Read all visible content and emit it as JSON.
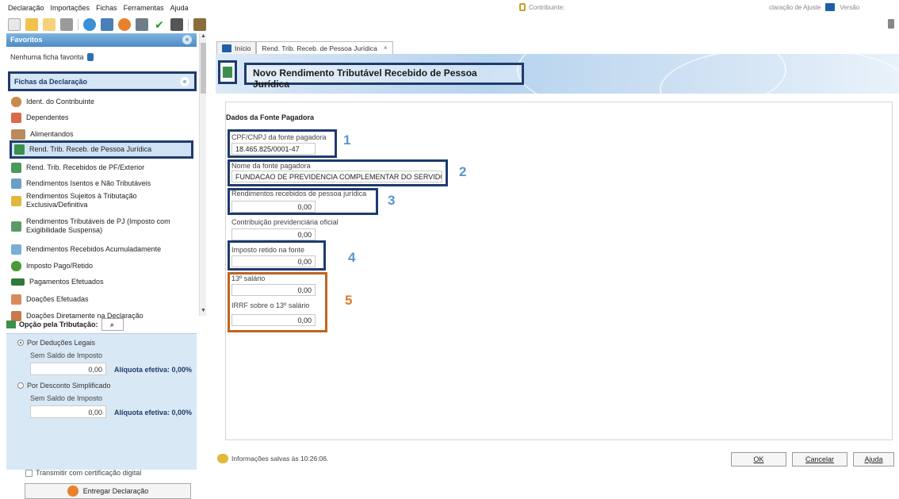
{
  "menu": [
    "Declaração",
    "Importações",
    "Fichas",
    "Ferramentas",
    "Ajuda"
  ],
  "top_status": {
    "contribuinte_label": "Contribuinte:",
    "declaracao_label": "claração de Ajuste",
    "versao_label": "Versão"
  },
  "sidebar": {
    "favoritos_header": "Favoritos",
    "favoritos_empty": "Nenhuma ficha favorita",
    "fichas_header": "Fichas da Declaração",
    "items": [
      {
        "label": "Ident. do Contribuinte",
        "icon": "person-icon"
      },
      {
        "label": "Dependentes",
        "icon": "dependents-icon"
      },
      {
        "label": "Alimentandos",
        "icon": "alimentandos-icon"
      },
      {
        "label": "Rend. Trib. Receb. de Pessoa Jurídica",
        "icon": "rendimento-pj-icon"
      },
      {
        "label": "Rend. Trib. Recebidos de PF/Exterior",
        "icon": "rendimento-pf-icon"
      },
      {
        "label": "Rendimentos Isentos e Não Tributáveis",
        "icon": "isentos-icon"
      },
      {
        "label": "Rendimentos Sujeitos à Tributação Exclusiva/Definitiva",
        "icon": "exclusiva-icon"
      },
      {
        "label": "Rendimentos Tributáveis de PJ (Imposto com Exigibilidade Suspensa)",
        "icon": "suspensa-icon"
      },
      {
        "label": "Rendimentos Recebidos Acumuladamente",
        "icon": "acumulados-icon"
      },
      {
        "label": "Imposto Pago/Retido",
        "icon": "imposto-pago-icon"
      },
      {
        "label": "Pagamentos Efetuados",
        "icon": "pagamentos-icon"
      },
      {
        "label": "Doações Efetuadas",
        "icon": "doacoes-icon"
      },
      {
        "label": "Doações Diretamente na Declaração",
        "icon": "doacoes-diretas-icon"
      }
    ],
    "opcao_label": "Opção pela Tributação:",
    "deducoes_legais": "Por Deduções Legais",
    "sem_saldo_1": "Sem Saldo de Imposto",
    "valor_1": "0,00",
    "aliquota_1": "Alíquota efetiva: 0,00%",
    "desconto_simplificado": "Por Desconto Simplificado",
    "sem_saldo_2": "Sem Saldo de Imposto",
    "valor_2": "0,00",
    "aliquota_2": "Alíquota efetiva: 0,00%",
    "transmitir": "Transmitir com certificação digital",
    "entregar": "Entregar Declaração"
  },
  "tabs": {
    "inicio": "Início",
    "active": "Rend. Trib. Receb. de Pessoa Jurídica",
    "close": "×"
  },
  "banner_title": "Novo Rendimento Tributável Recebido de Pessoa Jurídica",
  "form": {
    "section_title": "Dados da Fonte Pagadora",
    "cpf_cnpj_label": "CPF/CNPJ da fonte pagadora",
    "cpf_cnpj_value": "18.465.825/0001-47",
    "nome_label": "Nome da fonte pagadora",
    "nome_value": "FUNDACAO DE PREVIDENCIA COMPLEMENTAR DO SERVIDOR F",
    "rendimentos_label": "Rendimentos recebidos de pessoa jurídica",
    "rendimentos_value": "0,00",
    "contribuicao_label": "Contribuição previdenciária oficial",
    "contribuicao_value": "0,00",
    "imposto_label": "Imposto retido na fonte",
    "imposto_value": "0,00",
    "decimo_label": "13º salário",
    "decimo_value": "0,00",
    "irrf_decimo_label": "IRRF sobre o 13º salário",
    "irrf_decimo_value": "0,00",
    "callouts": [
      "1",
      "2",
      "3",
      "4",
      "5"
    ]
  },
  "status": {
    "message": "Informações salvas às 10:26:06.",
    "ok": "OK",
    "cancelar": "Cancelar",
    "ajuda": "Ajuda"
  },
  "colors": {
    "highlight_blue": "#1f3b6e",
    "highlight_orange": "#c0651f",
    "callout_blue": "#5a96cc",
    "callout_orange": "#e07b2a"
  }
}
